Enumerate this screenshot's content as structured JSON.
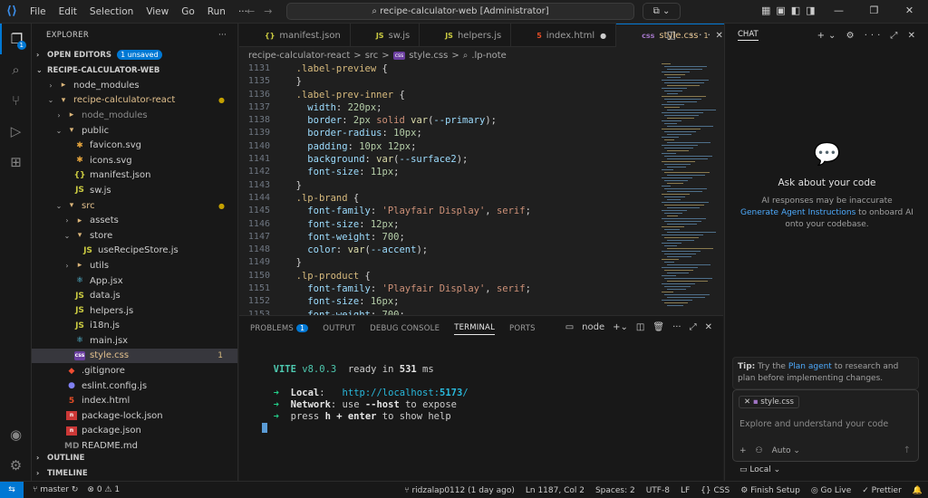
{
  "window": {
    "menu": [
      "File",
      "Edit",
      "Selection",
      "View",
      "Go",
      "Run",
      "···"
    ],
    "search": "recipe-calculator-web [Administrator]"
  },
  "activity": {
    "explorer_badge": "1"
  },
  "explorer": {
    "title": "EXPLORER",
    "open_editors": "OPEN EDITORS",
    "unsaved": "1 unsaved",
    "root": "RECIPE-CALCULATOR-WEB",
    "tree": [
      {
        "label": "node_modules",
        "icon": "▸",
        "cls": "i-folder",
        "indent": 1,
        "chev": "›",
        "state": ""
      },
      {
        "label": "recipe-calculator-react",
        "icon": "▾",
        "cls": "i-folder",
        "indent": 1,
        "chev": "⌄",
        "state": "mod",
        "dot": "●"
      },
      {
        "label": "node_modules",
        "icon": "▸",
        "cls": "i-folder",
        "indent": 2,
        "chev": "›",
        "state": "dim"
      },
      {
        "label": "public",
        "icon": "▾",
        "cls": "i-folder",
        "indent": 2,
        "chev": "⌄",
        "state": ""
      },
      {
        "label": "favicon.svg",
        "icon": "✱",
        "cls": "i-svg",
        "indent": 3,
        "chev": "",
        "state": ""
      },
      {
        "label": "icons.svg",
        "icon": "✱",
        "cls": "i-svg",
        "indent": 3,
        "chev": "",
        "state": ""
      },
      {
        "label": "manifest.json",
        "icon": "{}",
        "cls": "i-json",
        "indent": 3,
        "chev": "",
        "state": ""
      },
      {
        "label": "sw.js",
        "icon": "JS",
        "cls": "i-js",
        "indent": 3,
        "chev": "",
        "state": ""
      },
      {
        "label": "src",
        "icon": "▾",
        "cls": "i-folder",
        "indent": 2,
        "chev": "⌄",
        "state": "mod",
        "dot": "●"
      },
      {
        "label": "assets",
        "icon": "▸",
        "cls": "i-folder",
        "indent": 3,
        "chev": "›",
        "state": ""
      },
      {
        "label": "store",
        "icon": "▾",
        "cls": "i-folder",
        "indent": 3,
        "chev": "⌄",
        "state": ""
      },
      {
        "label": "useRecipeStore.js",
        "icon": "JS",
        "cls": "i-js",
        "indent": 4,
        "chev": "",
        "state": ""
      },
      {
        "label": "utils",
        "icon": "▸",
        "cls": "i-folder",
        "indent": 3,
        "chev": "›",
        "state": ""
      },
      {
        "label": "App.jsx",
        "icon": "⚛",
        "cls": "i-react",
        "indent": 3,
        "chev": "",
        "state": ""
      },
      {
        "label": "data.js",
        "icon": "JS",
        "cls": "i-js",
        "indent": 3,
        "chev": "",
        "state": ""
      },
      {
        "label": "helpers.js",
        "icon": "JS",
        "cls": "i-js",
        "indent": 3,
        "chev": "",
        "state": ""
      },
      {
        "label": "i18n.js",
        "icon": "JS",
        "cls": "i-js",
        "indent": 3,
        "chev": "",
        "state": ""
      },
      {
        "label": "main.jsx",
        "icon": "⚛",
        "cls": "i-react",
        "indent": 3,
        "chev": "",
        "state": ""
      },
      {
        "label": "style.css",
        "icon": "css",
        "cls": "i-css",
        "indent": 3,
        "chev": "",
        "state": "mod sel",
        "count": "1"
      },
      {
        "label": ".gitignore",
        "icon": "◆",
        "cls": "i-git",
        "indent": 2,
        "chev": "",
        "state": ""
      },
      {
        "label": "eslint.config.js",
        "icon": "●",
        "cls": "i-eslint",
        "indent": 2,
        "chev": "",
        "state": ""
      },
      {
        "label": "index.html",
        "icon": "5",
        "cls": "i-html",
        "indent": 2,
        "chev": "",
        "state": ""
      },
      {
        "label": "package-lock.json",
        "icon": "n",
        "cls": "i-npm",
        "indent": 2,
        "chev": "",
        "state": ""
      },
      {
        "label": "package.json",
        "icon": "n",
        "cls": "i-npm",
        "indent": 2,
        "chev": "",
        "state": ""
      },
      {
        "label": "README.md",
        "icon": "MD",
        "cls": "i-md",
        "indent": 2,
        "chev": "",
        "state": ""
      }
    ],
    "outline": "OUTLINE",
    "timeline": "TIMELINE"
  },
  "tabs": [
    {
      "label": "manifest.json",
      "icon": "{}",
      "color": "#cbcb41",
      "active": false,
      "mark": ""
    },
    {
      "label": "sw.js",
      "icon": "JS",
      "color": "#cbcb41",
      "active": false,
      "mark": ""
    },
    {
      "label": "helpers.js",
      "icon": "JS",
      "color": "#cbcb41",
      "active": false,
      "mark": ""
    },
    {
      "label": "index.html",
      "icon": "5",
      "color": "#e44d26",
      "active": false,
      "mark": "●"
    },
    {
      "label": "style.css",
      "icon": "css",
      "color": "#a074c4",
      "active": true,
      "mark": "1",
      "close": "✕"
    }
  ],
  "breadcrumb": [
    "recipe-calculator-react",
    ">",
    "src",
    ">",
    "css",
    "style.css",
    ">",
    "⌕",
    ".lp-note"
  ],
  "code": [
    {
      "n": "1131",
      "t": "  <span class=\"sel-c\">.label-preview</span> {"
    },
    {
      "n": "1135",
      "t": "  }"
    },
    {
      "n": "1136",
      "t": "  <span class=\"sel-c\">.label-prev-inner</span> {"
    },
    {
      "n": "1137",
      "t": "    <span class=\"prop\">width</span>: <span class=\"num\">220px</span>;"
    },
    {
      "n": "1138",
      "t": "    <span class=\"prop\">border</span>: <span class=\"num\">2px</span> <span class=\"kw\">solid</span> <span class=\"fn\">var</span>(<span class=\"var\">--primary</span>);"
    },
    {
      "n": "1139",
      "t": "    <span class=\"prop\">border-radius</span>: <span class=\"num\">10px</span>;"
    },
    {
      "n": "1140",
      "t": "    <span class=\"prop\">padding</span>: <span class=\"num\">10px 12px</span>;"
    },
    {
      "n": "1141",
      "t": "    <span class=\"prop\">background</span>: <span class=\"fn\">var</span>(<span class=\"var\">--surface2</span>);"
    },
    {
      "n": "1142",
      "t": "    <span class=\"prop\">font-size</span>: <span class=\"num\">11px</span>;"
    },
    {
      "n": "1143",
      "t": "  }"
    },
    {
      "n": "1144",
      "t": "  <span class=\"sel-c\">.lp-brand</span> {"
    },
    {
      "n": "1145",
      "t": "    <span class=\"prop\">font-family</span>: <span class=\"str\">'Playfair Display'</span>, <span class=\"kw\">serif</span>;"
    },
    {
      "n": "1146",
      "t": "    <span class=\"prop\">font-size</span>: <span class=\"num\">12px</span>;"
    },
    {
      "n": "1147",
      "t": "    <span class=\"prop\">font-weight</span>: <span class=\"num\">700</span>;"
    },
    {
      "n": "1148",
      "t": "    <span class=\"prop\">color</span>: <span class=\"fn\">var</span>(<span class=\"var\">--accent</span>);"
    },
    {
      "n": "1149",
      "t": "  }"
    },
    {
      "n": "1150",
      "t": "  <span class=\"sel-c\">.lp-product</span> {"
    },
    {
      "n": "1151",
      "t": "    <span class=\"prop\">font-family</span>: <span class=\"str\">'Playfair Display'</span>, <span class=\"kw\">serif</span>;"
    },
    {
      "n": "1152",
      "t": "    <span class=\"prop\">font-size</span>: <span class=\"num\">16px</span>;"
    },
    {
      "n": "1153",
      "t": "    <span class=\"prop\">font-weight</span>: <span class=\"num\">700</span>;"
    }
  ],
  "panel": {
    "tabs": [
      "PROBLEMS",
      "OUTPUT",
      "DEBUG CONSOLE",
      "TERMINAL",
      "PORTS"
    ],
    "problems_count": "1",
    "active": "TERMINAL",
    "terminal_name": "node",
    "lines": [
      {
        "h": ""
      },
      {
        "h": "  <span class=\"vite\">VITE</span> <span class=\"vite\" style=\"font-weight:normal\">v8.0.3</span>  ready in <span class=\"bold\">531</span> ms"
      },
      {
        "h": ""
      },
      {
        "h": "  <span class=\"arrow\">➜</span>  <span class=\"bold\">Local</span>:   <span class=\"link\">http://localhost:<b>5173</b>/</span>"
      },
      {
        "h": "  <span class=\"arrow\">➜</span>  <span class=\"bold\">Network</span>: use <span class=\"bold\">--host</span> to expose"
      },
      {
        "h": "  <span class=\"arrow\">➜</span>  press <span class=\"bold\">h + enter</span> to show help"
      }
    ]
  },
  "chat": {
    "title": "CHAT",
    "ask": "Ask about your code",
    "desc1": "AI responses may be inaccurate",
    "link": "Generate Agent Instructions",
    "desc2": " to onboard AI onto your codebase.",
    "tip_label": "Tip:",
    "tip_pre": " Try the ",
    "tip_link": "Plan agent",
    "tip_post": " to research and plan before implementing changes.",
    "attachment": "style.css",
    "placeholder": "Explore and understand your code",
    "mode": "Auto",
    "local": "Local"
  },
  "status": {
    "branch": "master",
    "errors": "⊗ 0  ⚠ 1",
    "author": "ridzalap0112 (1 day ago)",
    "position": "Ln 1187, Col 2",
    "spaces": "Spaces: 2",
    "encoding": "UTF-8",
    "eol": "LF",
    "lang": "CSS",
    "finish": "Finish Setup",
    "golive": "Go Live",
    "prettier": "Prettier"
  }
}
